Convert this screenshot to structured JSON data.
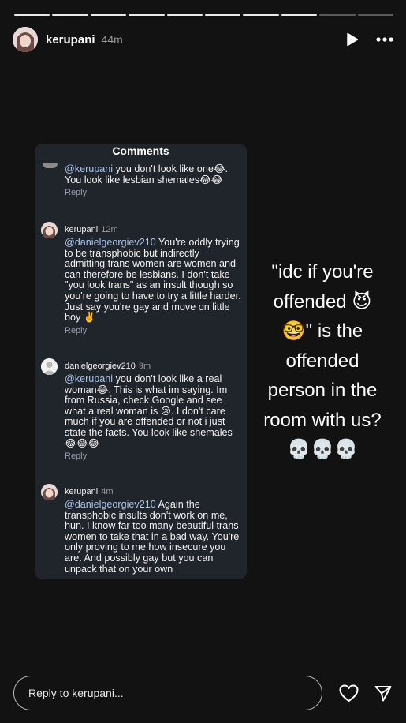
{
  "story": {
    "username": "kerupani",
    "time": "44m",
    "segments_total": 10,
    "segments_viewed": 8
  },
  "comments_card": {
    "title": "Comments",
    "comments": [
      {
        "mention": "@kerupani",
        "text": " you don't look like one😂. You look like lesbian shemales😂😂",
        "reply": "Reply"
      },
      {
        "username": "kerupani",
        "time": "12m",
        "mention": "@danielgeorgiev210",
        "text": " You're oddly trying to be transphobic but indirectly admitting trans women are women and can therefore be lesbians. I don't take \"you look trans\" as an insult though so you're going to have to try a little harder. Just say you're gay and move on little boy ✌️",
        "reply": "Reply"
      },
      {
        "username": "danielgeorgiev210",
        "time": "9m",
        "mention": "@kerupani",
        "text": " you don't look like a real woman😂. This is what im saying. Im from Russia, check Google and see what a real woman is 😢. I don't care much if you are offended or not i just state the facts. You look like shemales 😂😂😂",
        "reply": "Reply"
      },
      {
        "username": "kerupani",
        "time": "4m",
        "mention": "@danielgeorgiev210",
        "text": " Again the transphobic insults don't work on me, hun. I know far too many beautiful trans women to take that in a bad way. You're only proving to me how insecure you are. And possibly gay but you can unpack that on your own"
      }
    ]
  },
  "overlay_text": "\"idc if you're offended 😈🤓\" is the offended person in the room with us? 💀💀💀",
  "footer": {
    "reply_placeholder": "Reply to kerupani..."
  },
  "icons": [
    "play-icon",
    "more-icon",
    "heart-icon",
    "send-icon"
  ]
}
